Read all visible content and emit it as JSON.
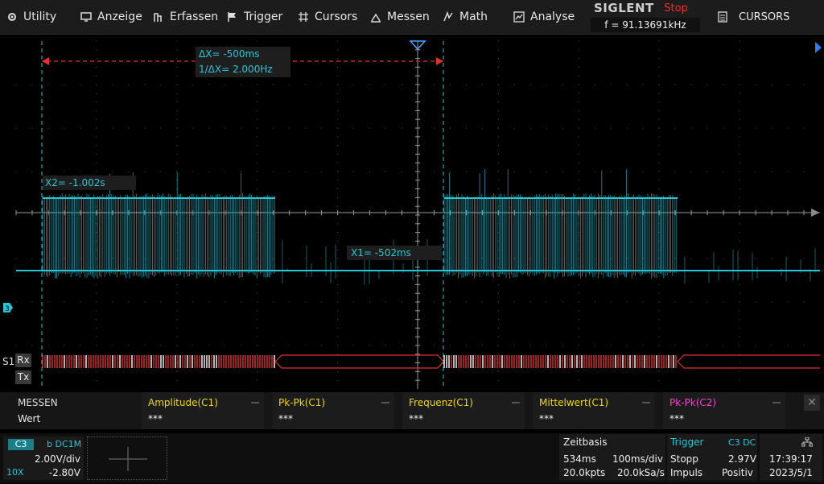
{
  "menu": {
    "items": [
      {
        "label": "Utility",
        "icon": "gear-icon"
      },
      {
        "label": "Anzeige",
        "icon": "display-icon"
      },
      {
        "label": "Erfassen",
        "icon": "acquire-icon"
      },
      {
        "label": "Trigger",
        "icon": "flag-icon"
      },
      {
        "label": "Cursors",
        "icon": "cursor-grid-icon"
      },
      {
        "label": "Messen",
        "icon": "measure-icon"
      },
      {
        "label": "Math",
        "icon": "math-icon"
      },
      {
        "label": "Analyse",
        "icon": "analyse-icon"
      }
    ]
  },
  "brand": {
    "name": "SIGLENT",
    "state": "Stop",
    "frequency": "f = 91.13691kHz"
  },
  "cursors_panel": {
    "label": "CURSORS",
    "icon": "document-icon"
  },
  "waveform": {
    "delta_x": "ΔX= -500ms",
    "inv_delta_x": "1/ΔX= 2.000Hz",
    "x2_label": "X2= -1.002s",
    "x1_label": "X1= -502ms",
    "bus_label": "S1",
    "rx_label": "Rx",
    "tx_label": "Tx",
    "trace_color": "#26c6d6",
    "decode_color": "#e03030"
  },
  "measure": {
    "header": "MESSEN",
    "row_label": "Wert",
    "items": [
      {
        "name": "Amplitude(C1)",
        "value": "***",
        "color": "#f0d800"
      },
      {
        "name": "Pk-Pk(C1)",
        "value": "***",
        "color": "#f0d800"
      },
      {
        "name": "Frequenz(C1)",
        "value": "***",
        "color": "#f0d800"
      },
      {
        "name": "Mittelwert(C1)",
        "value": "***",
        "color": "#f0d800"
      },
      {
        "name": "Pk-Pk(C2)",
        "value": "***",
        "color": "#ff3cd2"
      }
    ]
  },
  "channel": {
    "tag": "C3",
    "coupling": "b DC1M",
    "vdiv": "2.00V/div",
    "probe": "10X",
    "offset": "-2.80V"
  },
  "timebase": {
    "title": "Zeitbasis",
    "delay": "534ms",
    "tdiv": "100ms/div",
    "points": "20.0kpts",
    "rate": "20.0kSa/s"
  },
  "trigger": {
    "title": "Trigger",
    "source": "C3 DC",
    "state": "Stopp",
    "level": "2.97V",
    "type": "Impuls",
    "slope": "Positiv"
  },
  "clock": {
    "time": "17:39:17",
    "date": "2023/5/1"
  }
}
